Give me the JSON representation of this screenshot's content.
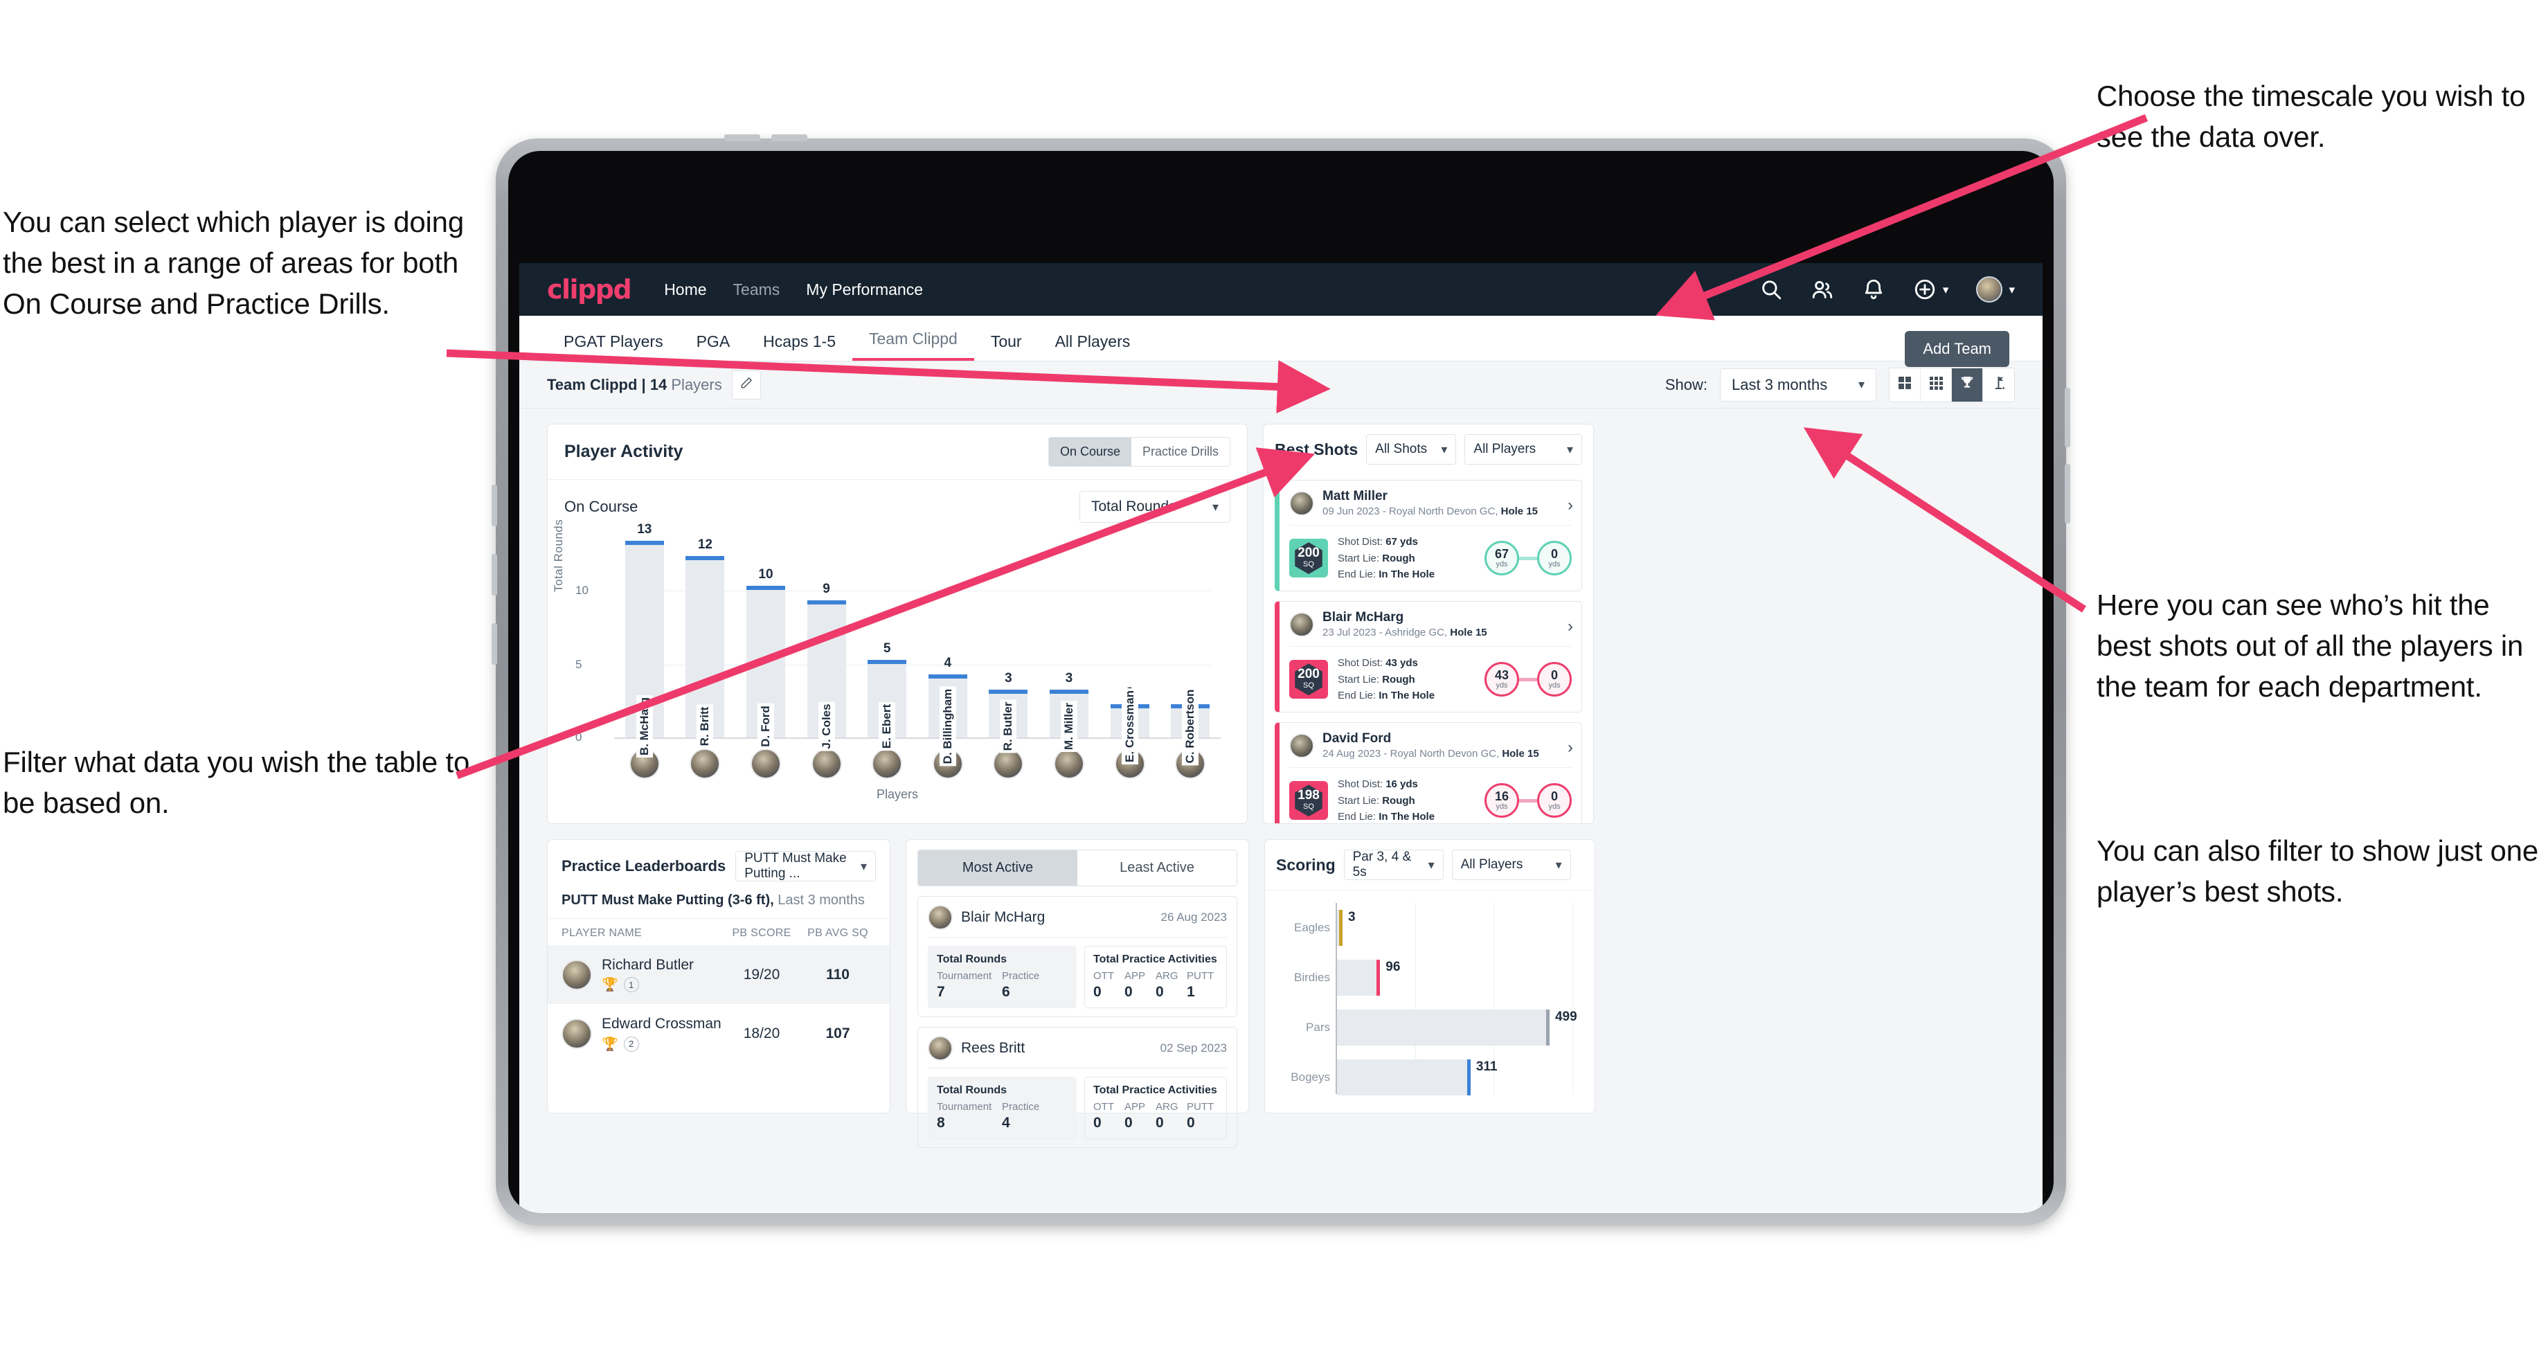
{
  "annotations": {
    "left_top": "You can select which player is doing the best in a range of areas for both On Course and Practice Drills.",
    "left_bottom": "Filter what data you wish the table to be based on.",
    "right_top": "Choose the timescale you wish to see the data over.",
    "right_middle": "Here you can see who’s hit the best shots out of all the players in the team for each department.",
    "right_bottom": "You can also filter to show just one player’s best shots."
  },
  "topnav": {
    "logo": "clippd",
    "links": [
      {
        "label": "Home",
        "dim": false
      },
      {
        "label": "Teams",
        "dim": true
      },
      {
        "label": "My Performance",
        "dim": false
      }
    ],
    "icons": [
      "search-icon",
      "people-icon",
      "bell-icon",
      "plus-circle-icon",
      "avatar"
    ]
  },
  "tabs": {
    "items": [
      {
        "label": "PGAT Players",
        "active": false
      },
      {
        "label": "PGA",
        "active": false
      },
      {
        "label": "Hcaps 1-5",
        "active": false
      },
      {
        "label": "Team Clippd",
        "active": true
      },
      {
        "label": "Tour",
        "active": false
      },
      {
        "label": "All Players",
        "active": false
      }
    ],
    "add_team_button": "Add Team"
  },
  "subheader": {
    "team_name": "Team Clippd",
    "separator": " | ",
    "player_count": "14",
    "players_word": " Players",
    "edit_icon": "pencil-icon",
    "show_label": "Show:",
    "show_value": "Last 3 months",
    "view_toggles": [
      {
        "icon": "grid-4-icon",
        "active": false
      },
      {
        "icon": "grid-9-icon",
        "active": false
      },
      {
        "icon": "trophy-icon",
        "active": true
      },
      {
        "icon": "flag-icon",
        "active": false
      }
    ]
  },
  "player_activity": {
    "title": "Player Activity",
    "segment": [
      {
        "label": "On Course",
        "active": true
      },
      {
        "label": "Practice Drills",
        "active": false
      }
    ],
    "sub_label": "On Course",
    "metric_select": "Total Rounds",
    "chart_data": {
      "type": "bar",
      "title": "Player Activity - On Course",
      "xlabel": "Players",
      "ylabel": "Total Rounds",
      "categories": [
        "B. McHarg",
        "R. Britt",
        "D. Ford",
        "J. Coles",
        "E. Ebert",
        "D. Billingham",
        "R. Butler",
        "M. Miller",
        "E. Crossman",
        "C. Robertson"
      ],
      "values": [
        13,
        12,
        10,
        9,
        5,
        4,
        3,
        3,
        2,
        2
      ],
      "yticks": [
        0,
        5,
        10
      ],
      "ylim": [
        0,
        14
      ],
      "bar_color": "#e7eaee",
      "cap_color": "#3b82d6",
      "grid": true
    }
  },
  "best_shots": {
    "title": "Best Shots",
    "shot_filter": "All Shots",
    "player_filter": "All Players",
    "cards": [
      {
        "name": "Matt Miller",
        "meta_date": "09 Jun 2023 - Royal North Devon GC, ",
        "meta_hole": "Hole 15",
        "badge_value": "200",
        "badge_unit": "SQ",
        "accent": "#5fd2b4",
        "shot_dist_label": "Shot Dist: ",
        "shot_dist": "67 yds",
        "start_lie_label": "Start Lie: ",
        "start_lie": "Rough",
        "end_lie_label": "End Lie: ",
        "end_lie": "In The Hole",
        "from_value": "67",
        "from_unit": "yds",
        "to_value": "0",
        "to_unit": "yds"
      },
      {
        "name": "Blair McHarg",
        "meta_date": "23 Jul 2023 - Ashridge GC, ",
        "meta_hole": "Hole 15",
        "badge_value": "200",
        "badge_unit": "SQ",
        "accent": "#ef3e6d",
        "shot_dist_label": "Shot Dist: ",
        "shot_dist": "43 yds",
        "start_lie_label": "Start Lie: ",
        "start_lie": "Rough",
        "end_lie_label": "End Lie: ",
        "end_lie": "In The Hole",
        "from_value": "43",
        "from_unit": "yds",
        "to_value": "0",
        "to_unit": "yds"
      },
      {
        "name": "David Ford",
        "meta_date": "24 Aug 2023 - Royal North Devon GC, ",
        "meta_hole": "Hole 15",
        "badge_value": "198",
        "badge_unit": "SQ",
        "accent": "#ef3e6d",
        "shot_dist_label": "Shot Dist: ",
        "shot_dist": "16 yds",
        "start_lie_label": "Start Lie: ",
        "start_lie": "Rough",
        "end_lie_label": "End Lie: ",
        "end_lie": "In The Hole",
        "from_value": "16",
        "from_unit": "yds",
        "to_value": "0",
        "to_unit": "yds"
      }
    ]
  },
  "practice_leaderboards": {
    "title": "Practice Leaderboards",
    "drill_select": "PUTT Must Make Putting ...",
    "subtitle_bold": "PUTT Must Make Putting (3-6 ft),",
    "subtitle_rest": " Last 3 months",
    "columns": [
      "PLAYER NAME",
      "PB SCORE",
      "PB AVG SQ"
    ],
    "rows": [
      {
        "name": "Richard Butler",
        "rank": "1",
        "trophy": "gold",
        "pb_score": "19/20",
        "pb_avg_sq": "110",
        "highlight": true
      },
      {
        "name": "Edward Crossman",
        "rank": "2",
        "trophy": "silver",
        "pb_score": "18/20",
        "pb_avg_sq": "107",
        "highlight": false
      }
    ]
  },
  "activity": {
    "tabs": [
      {
        "label": "Most Active",
        "active": true
      },
      {
        "label": "Least Active",
        "active": false
      }
    ],
    "cards": [
      {
        "name": "Blair McHarg",
        "date": "26 Aug 2023",
        "rounds_title": "Total Rounds",
        "rounds": [
          {
            "k": "Tournament",
            "v": "7"
          },
          {
            "k": "Practice",
            "v": "6"
          }
        ],
        "practice_title": "Total Practice Activities",
        "practice": [
          {
            "k": "OTT",
            "v": "0"
          },
          {
            "k": "APP",
            "v": "0"
          },
          {
            "k": "ARG",
            "v": "0"
          },
          {
            "k": "PUTT",
            "v": "1"
          }
        ]
      },
      {
        "name": "Rees Britt",
        "date": "02 Sep 2023",
        "rounds_title": "Total Rounds",
        "rounds": [
          {
            "k": "Tournament",
            "v": "8"
          },
          {
            "k": "Practice",
            "v": "4"
          }
        ],
        "practice_title": "Total Practice Activities",
        "practice": [
          {
            "k": "OTT",
            "v": "0"
          },
          {
            "k": "APP",
            "v": "0"
          },
          {
            "k": "ARG",
            "v": "0"
          },
          {
            "k": "PUTT",
            "v": "0"
          }
        ]
      }
    ]
  },
  "scoring": {
    "title": "Scoring",
    "par_select": "Par 3, 4 & 5s",
    "player_select": "All Players",
    "chart_data": {
      "type": "bar",
      "orientation": "horizontal",
      "title": "Scoring",
      "categories": [
        "Eagles",
        "Birdies",
        "Pars",
        "Bogeys"
      ],
      "values": [
        3,
        96,
        499,
        311
      ],
      "xlim": [
        0,
        560
      ],
      "colors": [
        "#c9a227",
        "#ef3e6d",
        "#9aa3ad",
        "#3b82d6"
      ],
      "bar_color": "#e7eaee",
      "grid": true
    }
  }
}
